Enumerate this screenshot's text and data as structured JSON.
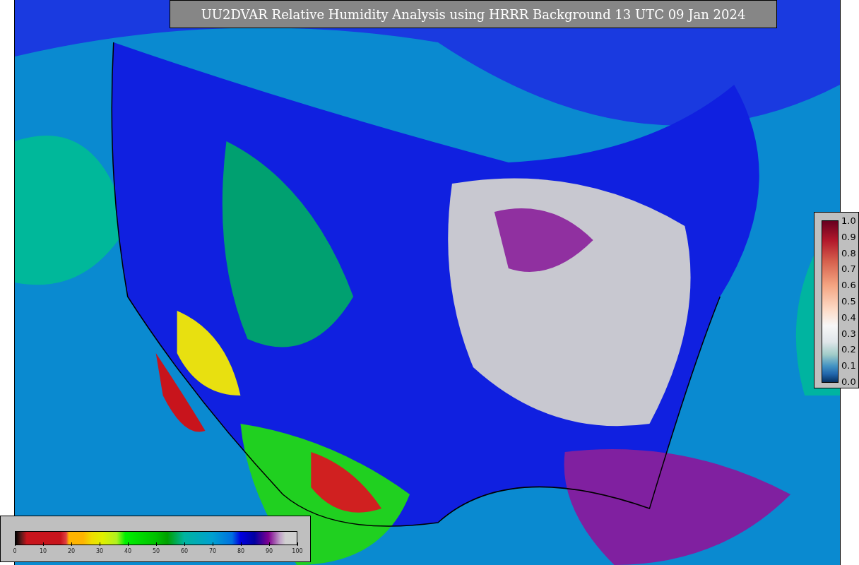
{
  "title": "UU2DVAR Relative Humidity Analysis using HRRR Background 13 UTC 09 Jan 2024",
  "humidity_colorbar": {
    "ticks": [
      "0",
      "10",
      "20",
      "30",
      "40",
      "50",
      "60",
      "70",
      "80",
      "90",
      "100"
    ]
  },
  "ratio_colorbar": {
    "ticks": [
      "1.0",
      "0.9",
      "0.8",
      "0.7",
      "0.6",
      "0.5",
      "0.4",
      "0.3",
      "0.2",
      "0.1",
      "0.0"
    ]
  }
}
